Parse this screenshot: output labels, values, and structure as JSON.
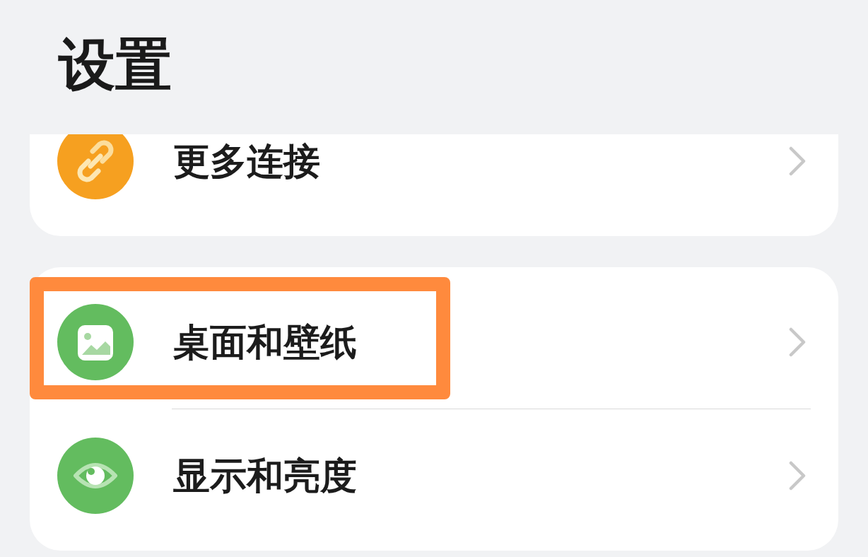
{
  "header": {
    "title": "设置"
  },
  "sections": [
    {
      "items": [
        {
          "label": "更多连接",
          "kind": "link",
          "highlighted": false
        }
      ]
    },
    {
      "items": [
        {
          "label": "桌面和壁纸",
          "kind": "wallpaper",
          "highlighted": true
        },
        {
          "label": "显示和亮度",
          "kind": "eye",
          "highlighted": false
        }
      ]
    }
  ]
}
